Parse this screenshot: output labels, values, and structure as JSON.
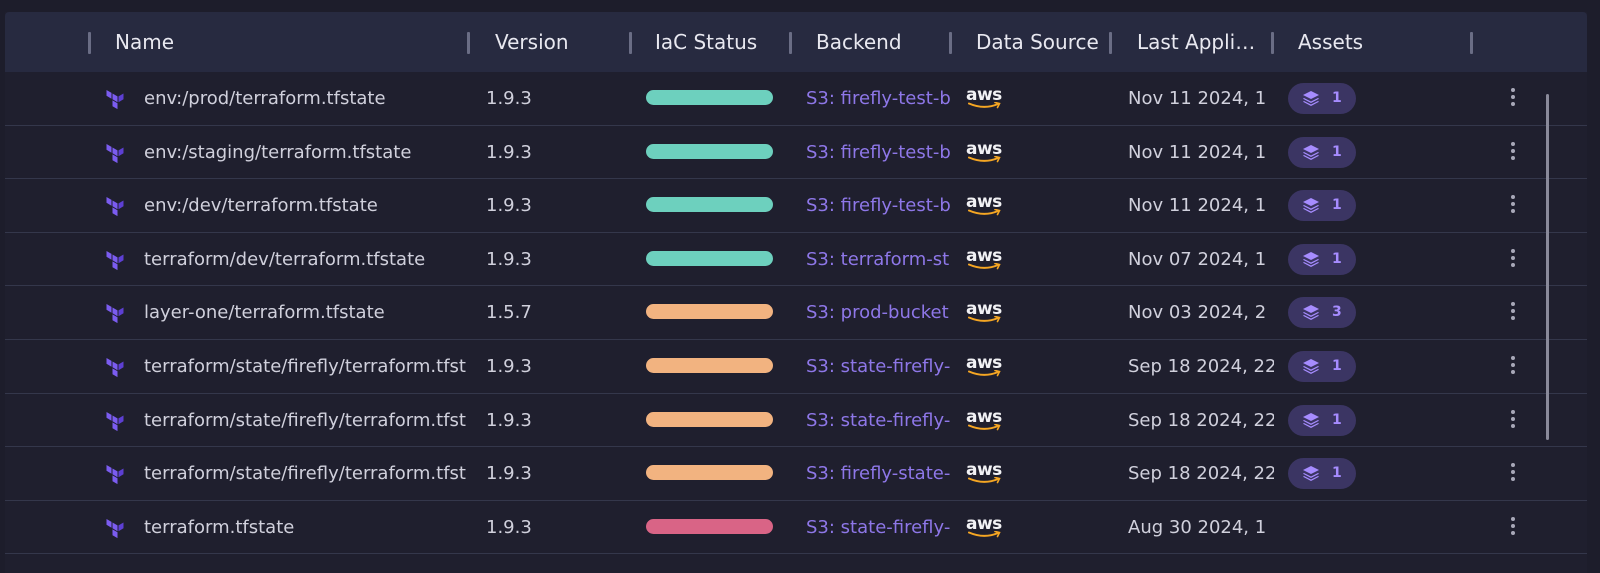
{
  "columns": {
    "name": "Name",
    "version": "Version",
    "iac_status": "IaC Status",
    "backend": "Backend",
    "data_source": "Data Source",
    "last_applied": "Last Appli…",
    "assets": "Assets"
  },
  "status_colors": {
    "green": "#6dd0be",
    "orange": "#f2b380",
    "red": "#d96486"
  },
  "rows": [
    {
      "name": "env:/prod/terraform.tfstate",
      "version": "1.9.3",
      "status": "green",
      "backend": "S3: firefly-test-b",
      "data_source": "aws",
      "last_applied": "Nov 11 2024, 1",
      "assets": "1"
    },
    {
      "name": "env:/staging/terraform.tfstate",
      "version": "1.9.3",
      "status": "green",
      "backend": "S3: firefly-test-b",
      "data_source": "aws",
      "last_applied": "Nov 11 2024, 1",
      "assets": "1"
    },
    {
      "name": "env:/dev/terraform.tfstate",
      "version": "1.9.3",
      "status": "green",
      "backend": "S3: firefly-test-b",
      "data_source": "aws",
      "last_applied": "Nov 11 2024, 1",
      "assets": "1"
    },
    {
      "name": "terraform/dev/terraform.tfstate",
      "version": "1.9.3",
      "status": "green",
      "backend": "S3: terraform-st",
      "data_source": "aws",
      "last_applied": "Nov 07 2024, 1",
      "assets": "1"
    },
    {
      "name": "layer-one/terraform.tfstate",
      "version": "1.5.7",
      "status": "orange",
      "backend": "S3: prod-bucket",
      "data_source": "aws",
      "last_applied": "Nov 03 2024, 2",
      "assets": "3"
    },
    {
      "name": "terraform/state/firefly/terraform.tfst",
      "version": "1.9.3",
      "status": "orange",
      "backend": "S3: state-firefly-",
      "data_source": "aws",
      "last_applied": "Sep 18 2024, 22",
      "assets": "1"
    },
    {
      "name": "terraform/state/firefly/terraform.tfst",
      "version": "1.9.3",
      "status": "orange",
      "backend": "S3: state-firefly-",
      "data_source": "aws",
      "last_applied": "Sep 18 2024, 22",
      "assets": "1"
    },
    {
      "name": "terraform/state/firefly/terraform.tfst",
      "version": "1.9.3",
      "status": "orange",
      "backend": "S3: firefly-state-",
      "data_source": "aws",
      "last_applied": "Sep 18 2024, 22",
      "assets": "1"
    },
    {
      "name": "terraform.tfstate",
      "version": "1.9.3",
      "status": "red",
      "backend": "S3: state-firefly-",
      "data_source": "aws",
      "last_applied": "Aug 30 2024, 1",
      "assets": null
    }
  ]
}
